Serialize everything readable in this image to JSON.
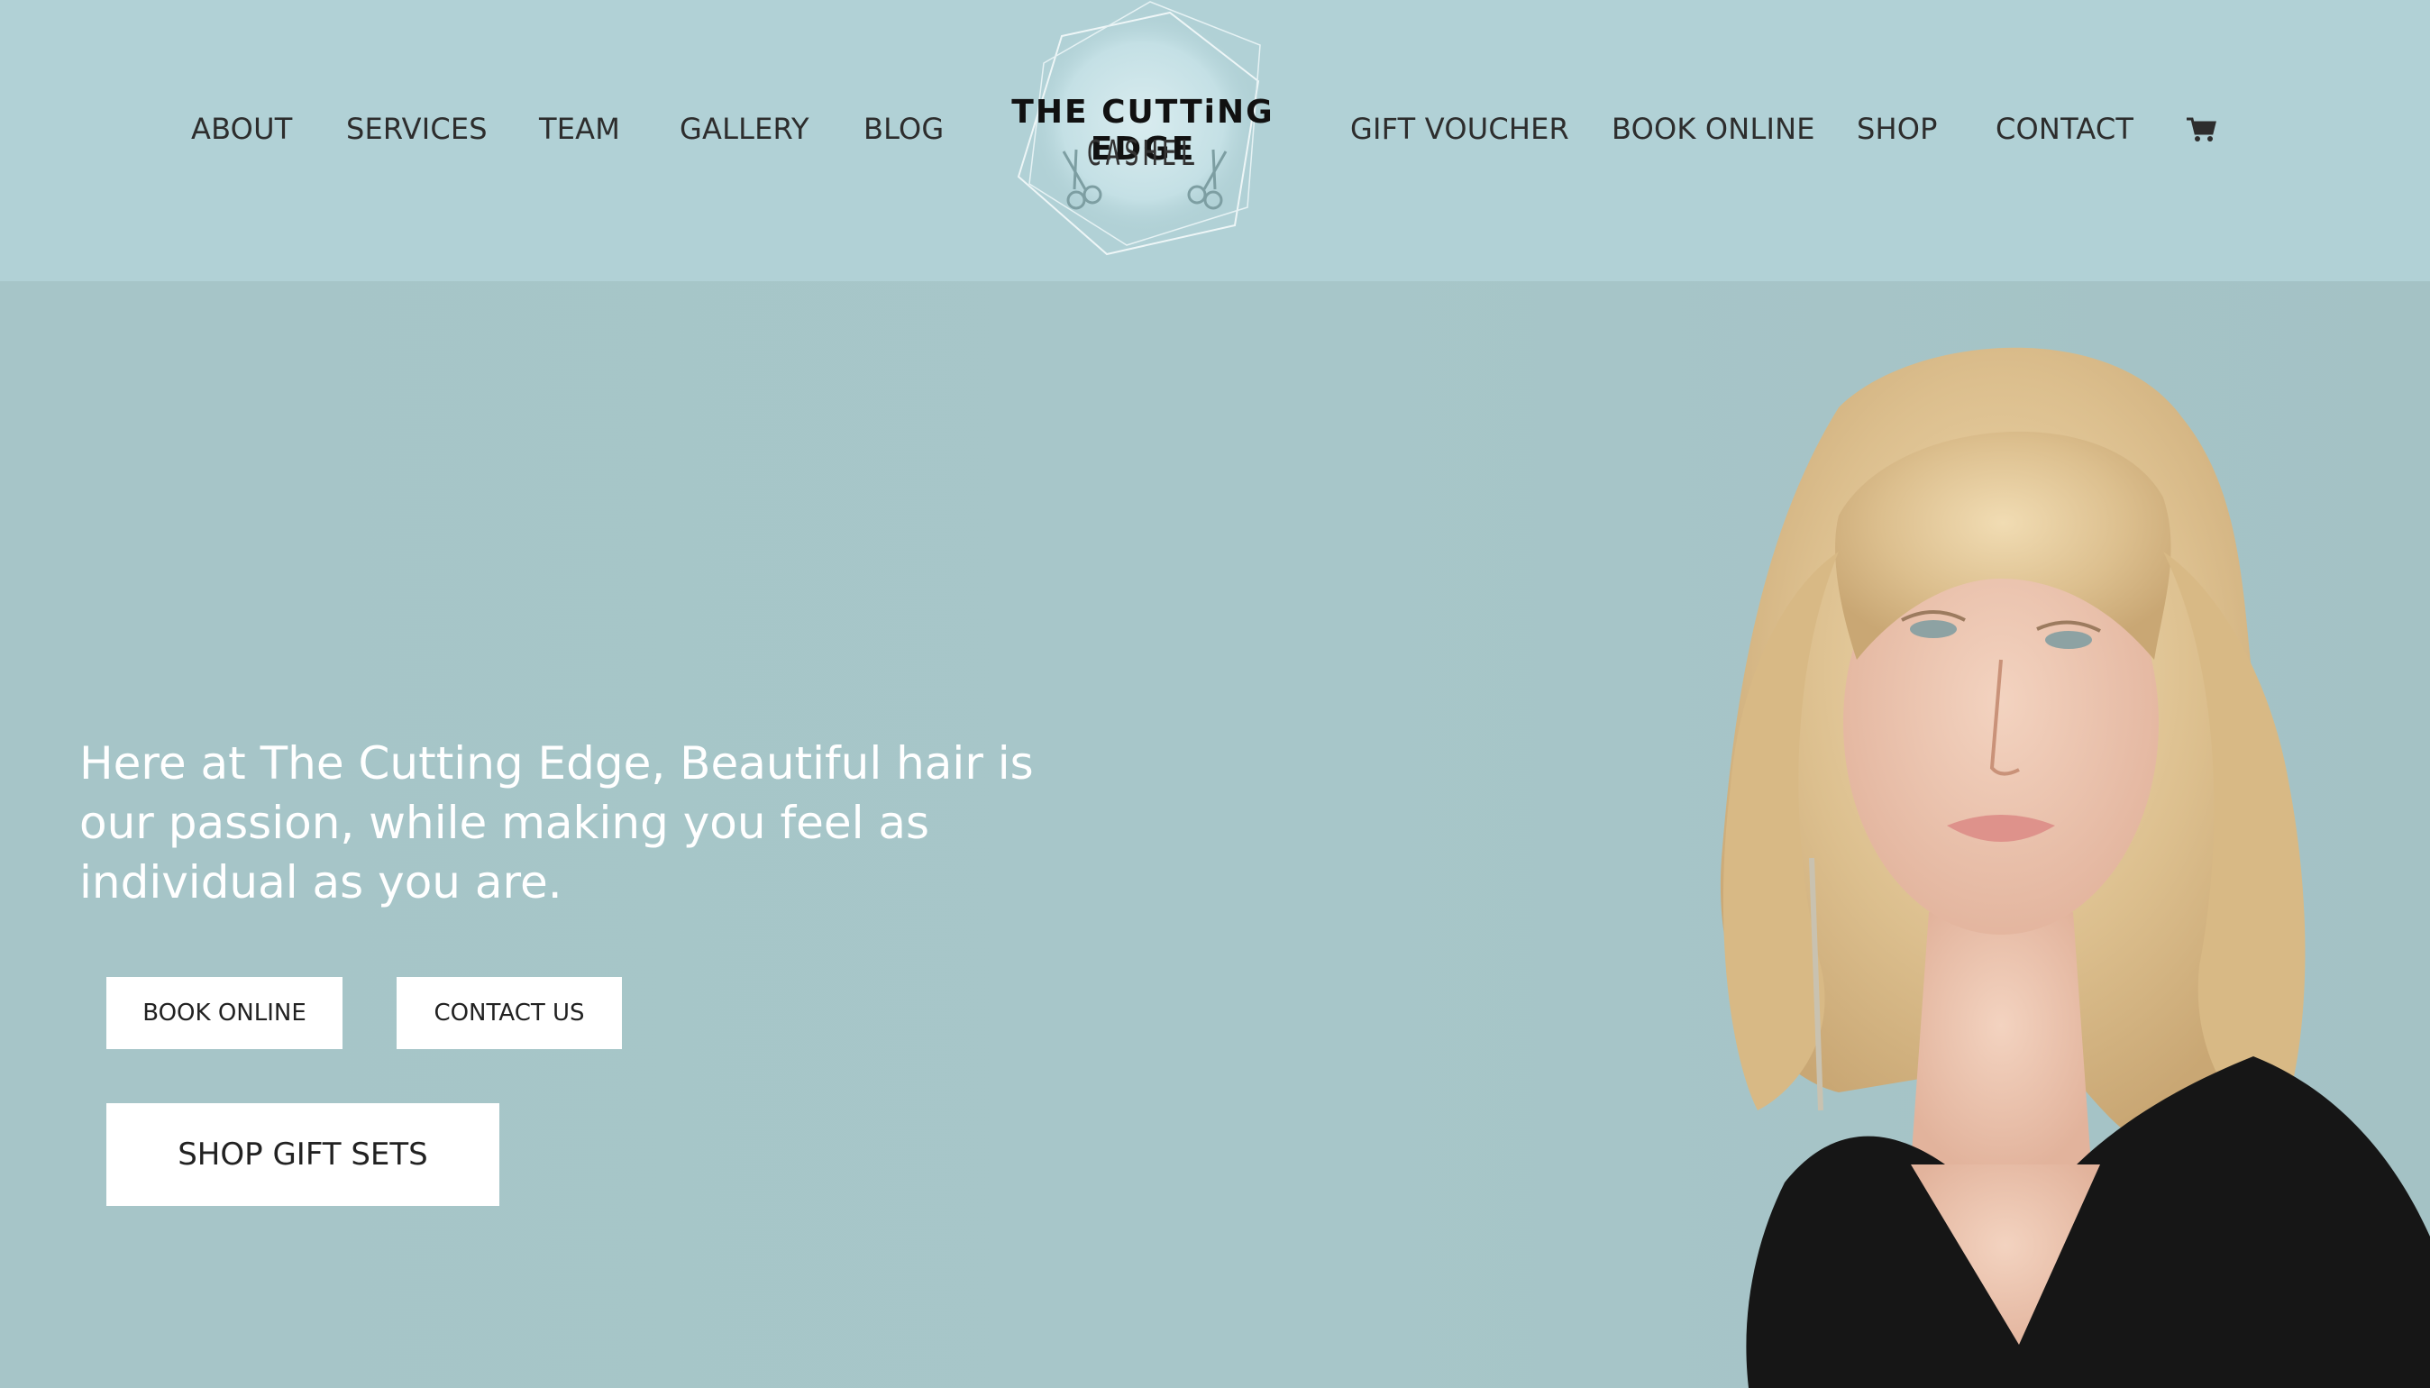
{
  "nav": {
    "left": [
      "ABOUT",
      "SERVICES",
      "TEAM",
      "GALLERY",
      "BLOG"
    ],
    "right": [
      "GIFT VOUCHER",
      "BOOK ONLINE",
      "SHOP",
      "CONTACT"
    ],
    "cart_icon": "shopping-cart-icon"
  },
  "logo": {
    "title": "THE CUTTiNG EDGE",
    "subtitle": "CASHEL"
  },
  "hero": {
    "headline": "Here at The Cutting Edge, Beautiful hair is our passion, while making you feel as individual as you are.",
    "book_label": "BOOK ONLINE",
    "contact_label": "CONTACT US",
    "shop_label": "SHOP GIFT SETS"
  },
  "colors": {
    "header_bg": "#b1d1d6",
    "hero_bg": "#a7c6c9",
    "nav_text": "#2d2d2d",
    "button_bg": "#ffffff"
  }
}
